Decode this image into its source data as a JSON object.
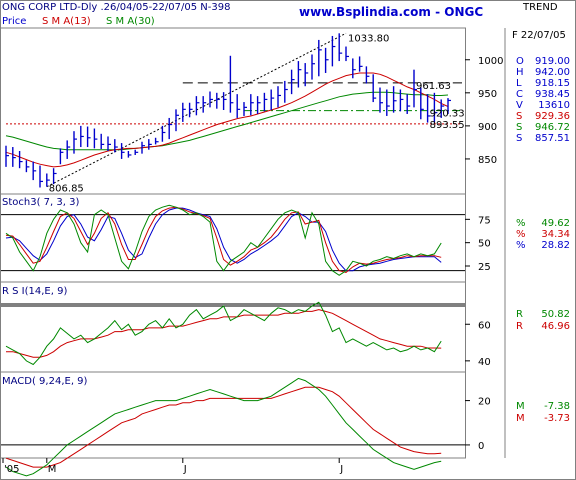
{
  "header": {
    "title_left": "ONG CORP LTD-Dly .26/04/05-22/07/05  N-398",
    "site": "www.Bsplindia.com - ONGC",
    "trend": "TREND",
    "legend_price": "Price",
    "legend_sma13": "S M A(13)",
    "legend_sma30": "S M A(30)"
  },
  "colors": {
    "price": "#0000cc",
    "sma13": "#cc0000",
    "sma30": "#008800",
    "stoch_k": "#008800",
    "stoch_d": "#cc0000",
    "stoch_slow": "#0000cc",
    "grid": "#000000",
    "panel_border": "#808080"
  },
  "side_panel": {
    "date": "F 22/07/05",
    "items": [
      {
        "label": "O",
        "value": "919.00",
        "color": "#0000cc"
      },
      {
        "label": "H",
        "value": "942.00",
        "color": "#0000cc"
      },
      {
        "label": "L",
        "value": "918.15",
        "color": "#0000cc"
      },
      {
        "label": "C",
        "value": "938.45",
        "color": "#0000cc"
      },
      {
        "label": "V",
        "value": "13610",
        "color": "#0000cc"
      },
      {
        "label": "S",
        "value": "929.36",
        "color": "#cc0000"
      },
      {
        "label": "S",
        "value": "946.72",
        "color": "#008800"
      },
      {
        "label": "S",
        "value": "857.51",
        "color": "#0000cc"
      }
    ],
    "stoch_values": [
      {
        "label": "%",
        "value": "49.62",
        "color": "#008800"
      },
      {
        "label": "%",
        "value": "34.34",
        "color": "#cc0000"
      },
      {
        "label": "%",
        "value": "28.82",
        "color": "#0000cc"
      }
    ],
    "rsi_values": [
      {
        "label": "R",
        "value": "50.82",
        "color": "#008800"
      },
      {
        "label": "R",
        "value": "46.96",
        "color": "#cc0000"
      }
    ],
    "macd_values": [
      {
        "label": "M",
        "value": "-7.38",
        "color": "#008800"
      },
      {
        "label": "M",
        "value": "-3.73",
        "color": "#cc0000"
      }
    ]
  },
  "chart_data": [
    {
      "type": "line",
      "panel": "price",
      "title": "ONG CORP LTD-Dly .26/04/05-22/07/05  N-398",
      "ylim": [
        800,
        1045
      ],
      "yticks": [
        "1000",
        "950",
        "900",
        "850"
      ],
      "xticks": [
        "'05",
        "M",
        "J",
        "J"
      ],
      "annotations": [
        {
          "text": "1033.80",
          "x": 50,
          "y": 1033.8
        },
        {
          "text": "961.63",
          "x": 60,
          "y": 961.63
        },
        {
          "text": "920.33",
          "x": 62,
          "y": 920.33
        },
        {
          "text": "893.55",
          "x": 62,
          "y": 903
        },
        {
          "text": "806.85",
          "x": 6,
          "y": 806.85
        }
      ],
      "horizontal_lines": [
        {
          "y": 965,
          "style": "dashed",
          "color": "#000000",
          "x_from": 26
        },
        {
          "y": 923,
          "style": "dashdot",
          "color": "#008800",
          "x_from": 35
        },
        {
          "y": 903,
          "style": "dotted",
          "color": "#cc0000",
          "x_from": 0
        }
      ],
      "trendline": {
        "x": [
          6,
          50
        ],
        "y": [
          808,
          1040
        ],
        "style": "dotted"
      },
      "series": [
        {
          "name": "Price",
          "style": "ohlc",
          "high": [
            870,
            868,
            862,
            848,
            846,
            840,
            828,
            836,
            866,
            878,
            892,
            900,
            899,
            896,
            888,
            884,
            880,
            874,
            862,
            864,
            876,
            880,
            882,
            900,
            912,
            925,
            935,
            935,
            945,
            945,
            952,
            950,
            951,
            1006,
            948,
            936,
            948,
            945,
            950,
            955,
            960,
            968,
            985,
            998,
            995,
            1008,
            1030,
            1018,
            1036,
            1040,
            1020,
            1002,
            1005,
            990,
            978,
            958,
            955,
            960,
            955,
            948,
            985,
            958,
            948,
            950,
            940,
            942
          ],
          "low": [
            838,
            838,
            836,
            830,
            818,
            806.85,
            808,
            812,
            842,
            850,
            858,
            868,
            868,
            866,
            865,
            862,
            860,
            850,
            852,
            856,
            858,
            864,
            872,
            876,
            880,
            892,
            906,
            913,
            916,
            920,
            928,
            926,
            924,
            920,
            912,
            915,
            916,
            918,
            922,
            924,
            928,
            935,
            948,
            958,
            960,
            970,
            975,
            980,
            990,
            998,
            998,
            972,
            982,
            964,
            936,
            920,
            915,
            920,
            922,
            918,
            928,
            910,
            905,
            905,
            912,
            918
          ],
          "close": [
            855,
            852,
            846,
            838,
            832,
            816,
            818,
            828,
            860,
            868,
            880,
            884,
            882,
            880,
            872,
            872,
            868,
            860,
            856,
            860,
            870,
            872,
            876,
            890,
            902,
            916,
            925,
            925,
            935,
            935,
            940,
            940,
            940,
            935,
            925,
            928,
            935,
            935,
            940,
            942,
            946,
            955,
            970,
            985,
            980,
            994,
            1015,
            1000,
            1020,
            1010,
            1005,
            985,
            990,
            975,
            942,
            935,
            930,
            938,
            940,
            930,
            955,
            925,
            915,
            920,
            930,
            938.45
          ]
        },
        {
          "name": "S M A(13)",
          "values": [
            860,
            857,
            853,
            849,
            845,
            842,
            840,
            838,
            839,
            841,
            844,
            848,
            852,
            856,
            859,
            862,
            864,
            865,
            866,
            866,
            867,
            868,
            869,
            871,
            874,
            878,
            882,
            886,
            890,
            894,
            898,
            902,
            905,
            908,
            911,
            913,
            915,
            918,
            921,
            924,
            927,
            931,
            935,
            940,
            945,
            951,
            957,
            963,
            968,
            972,
            976,
            978,
            980,
            980,
            980,
            978,
            974,
            969,
            964,
            959,
            955,
            950,
            945,
            940,
            934,
            929.36
          ]
        },
        {
          "name": "S M A(30)",
          "values": [
            885,
            883,
            880,
            877,
            874,
            871,
            868,
            866,
            865,
            864,
            864,
            864,
            864,
            864,
            864,
            864,
            864,
            864,
            865,
            866,
            867,
            868,
            869,
            870,
            872,
            874,
            876,
            878,
            881,
            884,
            887,
            890,
            893,
            896,
            899,
            902,
            905,
            908,
            911,
            914,
            917,
            920,
            923,
            926,
            929,
            932,
            935,
            938,
            941,
            944,
            946,
            948,
            949,
            950,
            951,
            951,
            951,
            950,
            949,
            948,
            947,
            947,
            947,
            946,
            946,
            946.72
          ]
        }
      ]
    },
    {
      "type": "line",
      "panel": "stochastic",
      "title": "Stoch3( 7, 3, 3)",
      "ylim": [
        10,
        100
      ],
      "yticks": [
        "75",
        "50",
        "25"
      ],
      "reference_lines": [
        20,
        80
      ],
      "series": [
        {
          "name": "%K",
          "values": [
            60,
            55,
            40,
            30,
            20,
            35,
            60,
            75,
            85,
            82,
            70,
            50,
            40,
            80,
            85,
            80,
            55,
            30,
            22,
            40,
            62,
            78,
            85,
            88,
            90,
            88,
            85,
            80,
            82,
            78,
            72,
            30,
            20,
            30,
            35,
            40,
            50,
            45,
            55,
            65,
            75,
            82,
            85,
            82,
            55,
            82,
            70,
            30,
            20,
            15,
            20,
            30,
            28,
            25,
            30,
            32,
            35,
            33,
            36,
            38,
            35,
            38,
            36,
            38,
            49.62
          ]
        },
        {
          "name": "%D",
          "values": [
            58,
            57,
            48,
            38,
            28,
            30,
            45,
            62,
            78,
            82,
            76,
            62,
            48,
            60,
            76,
            82,
            70,
            48,
            32,
            32,
            48,
            65,
            78,
            84,
            87,
            88,
            86,
            83,
            81,
            79,
            76,
            55,
            32,
            26,
            30,
            35,
            42,
            45,
            50,
            56,
            65,
            75,
            82,
            83,
            70,
            72,
            74,
            50,
            30,
            20,
            18,
            24,
            28,
            27,
            28,
            30,
            32,
            33,
            34,
            36,
            35,
            36,
            36,
            36,
            34.34
          ]
        },
        {
          "name": "%D slow",
          "values": [
            55,
            56,
            52,
            44,
            36,
            31,
            38,
            52,
            68,
            78,
            80,
            70,
            56,
            52,
            64,
            78,
            76,
            60,
            42,
            34,
            38,
            55,
            70,
            80,
            85,
            87,
            87,
            85,
            82,
            80,
            78,
            65,
            45,
            32,
            28,
            32,
            38,
            42,
            47,
            52,
            58,
            68,
            78,
            82,
            78,
            72,
            72,
            62,
            42,
            28,
            20,
            20,
            24,
            26,
            27,
            28,
            30,
            32,
            33,
            34,
            35,
            35,
            35,
            35,
            28.82
          ]
        }
      ]
    },
    {
      "type": "line",
      "panel": "rsi",
      "title": "R S I(14,E, 9)",
      "ylim": [
        35,
        82
      ],
      "yticks": [
        "60",
        "40"
      ],
      "reference_lines": [
        30,
        70
      ],
      "series": [
        {
          "name": "RSI",
          "values": [
            48,
            46,
            44,
            40,
            38,
            42,
            48,
            52,
            58,
            55,
            52,
            54,
            50,
            52,
            55,
            58,
            62,
            57,
            60,
            54,
            56,
            60,
            62,
            58,
            63,
            58,
            60,
            65,
            68,
            63,
            65,
            67,
            70,
            62,
            64,
            68,
            66,
            64,
            62,
            66,
            69,
            68,
            66,
            68,
            67,
            70,
            72,
            65,
            56,
            58,
            50,
            52,
            50,
            48,
            50,
            48,
            46,
            47,
            45,
            46,
            48,
            46,
            47,
            45,
            50.82
          ]
        },
        {
          "name": "Signal",
          "values": [
            45,
            45,
            44,
            43,
            42,
            42,
            43,
            45,
            48,
            50,
            51,
            52,
            52,
            52,
            53,
            54,
            56,
            56,
            57,
            57,
            57,
            58,
            58,
            58,
            59,
            59,
            59,
            60,
            61,
            62,
            63,
            63,
            64,
            64,
            64,
            65,
            65,
            65,
            65,
            65,
            65,
            66,
            66,
            66,
            67,
            67,
            68,
            67,
            66,
            64,
            62,
            60,
            58,
            56,
            54,
            52,
            51,
            50,
            49,
            48,
            48,
            48,
            47,
            47,
            46.96
          ]
        }
      ]
    },
    {
      "type": "line",
      "panel": "macd",
      "title": "MACD( 9,24,E, 9)",
      "ylim": [
        -5,
        32
      ],
      "yticks": [
        "20",
        "0"
      ],
      "reference_lines": [
        0
      ],
      "series": [
        {
          "name": "MACD",
          "values": [
            -10,
            -12,
            -13,
            -14,
            -13,
            -11,
            -9,
            -6,
            -3,
            0,
            2,
            4,
            6,
            8,
            10,
            12,
            14,
            15,
            16,
            17,
            18,
            19,
            20,
            20,
            20,
            20,
            21,
            22,
            23,
            24,
            25,
            24,
            23,
            22,
            21,
            20,
            20,
            20,
            21,
            22,
            24,
            26,
            28,
            30,
            29,
            27,
            25,
            22,
            18,
            14,
            10,
            7,
            4,
            1,
            -2,
            -4,
            -6,
            -8,
            -9,
            -10,
            -11,
            -10,
            -9,
            -8,
            -7.38
          ]
        },
        {
          "name": "Signal",
          "values": [
            -6,
            -7,
            -8,
            -9,
            -10,
            -10,
            -10,
            -9,
            -8,
            -6,
            -4,
            -2,
            0,
            2,
            4,
            6,
            8,
            10,
            11,
            12,
            14,
            15,
            16,
            17,
            18,
            18,
            19,
            19,
            20,
            20,
            21,
            21,
            21,
            21,
            21,
            21,
            21,
            21,
            21,
            21,
            22,
            23,
            24,
            25,
            26,
            26,
            26,
            25,
            24,
            22,
            19,
            16,
            13,
            10,
            7,
            5,
            3,
            1,
            -1,
            -2,
            -3,
            -3.5,
            -4,
            -4,
            -3.73
          ]
        }
      ]
    }
  ]
}
